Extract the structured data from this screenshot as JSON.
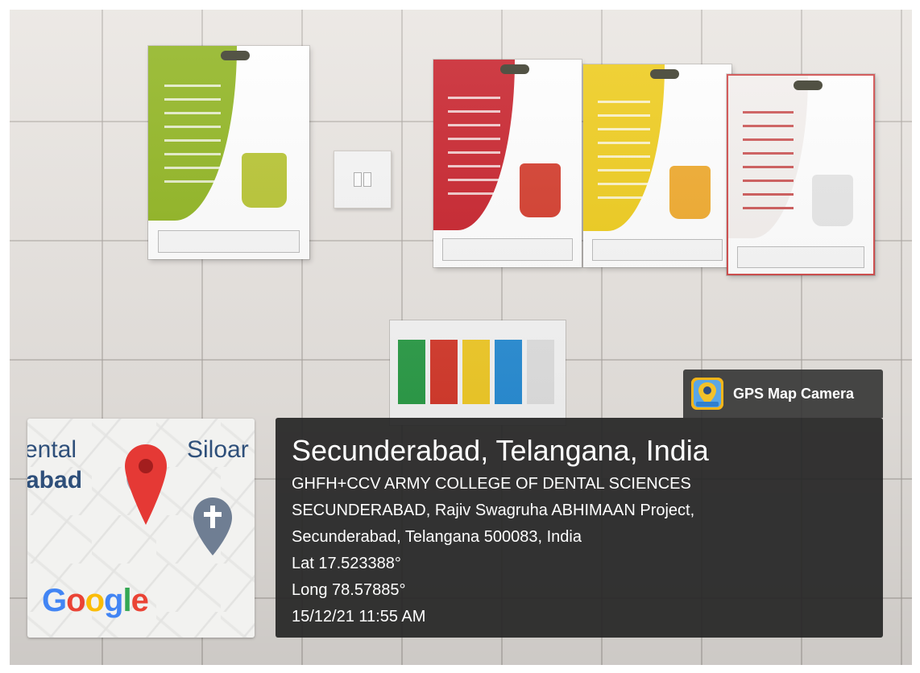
{
  "app": {
    "name": "GPS Map Camera",
    "icon": "gps-map-camera-icon"
  },
  "map": {
    "labels": [
      "ental",
      "abad",
      "Siloar"
    ],
    "pin_icon": "map-pin-icon",
    "poi_icon": "church-pin-icon",
    "attribution": "Google",
    "colors": {
      "pin": "#e53935",
      "poi": "#6f7e93",
      "label": "#2e4f7a"
    }
  },
  "location": {
    "city_line": "Secunderabad, Telangana, India",
    "address_lines": [
      "GHFH+CCV ARMY COLLEGE OF DENTAL SCIENCES",
      "SECUNDERABAD, Rajiv Swagruha ABHIMAAN Project,",
      "Secunderabad, Telangana 500083, India"
    ],
    "lat": "Lat 17.523388°",
    "long": "Long 78.57885°",
    "datetime": "15/12/21 11:55 AM"
  },
  "colors": {
    "panel_bg": "#262626",
    "google": [
      "#4285F4",
      "#EA4335",
      "#FBBC05",
      "#4285F4",
      "#34A853",
      "#EA4335"
    ]
  }
}
